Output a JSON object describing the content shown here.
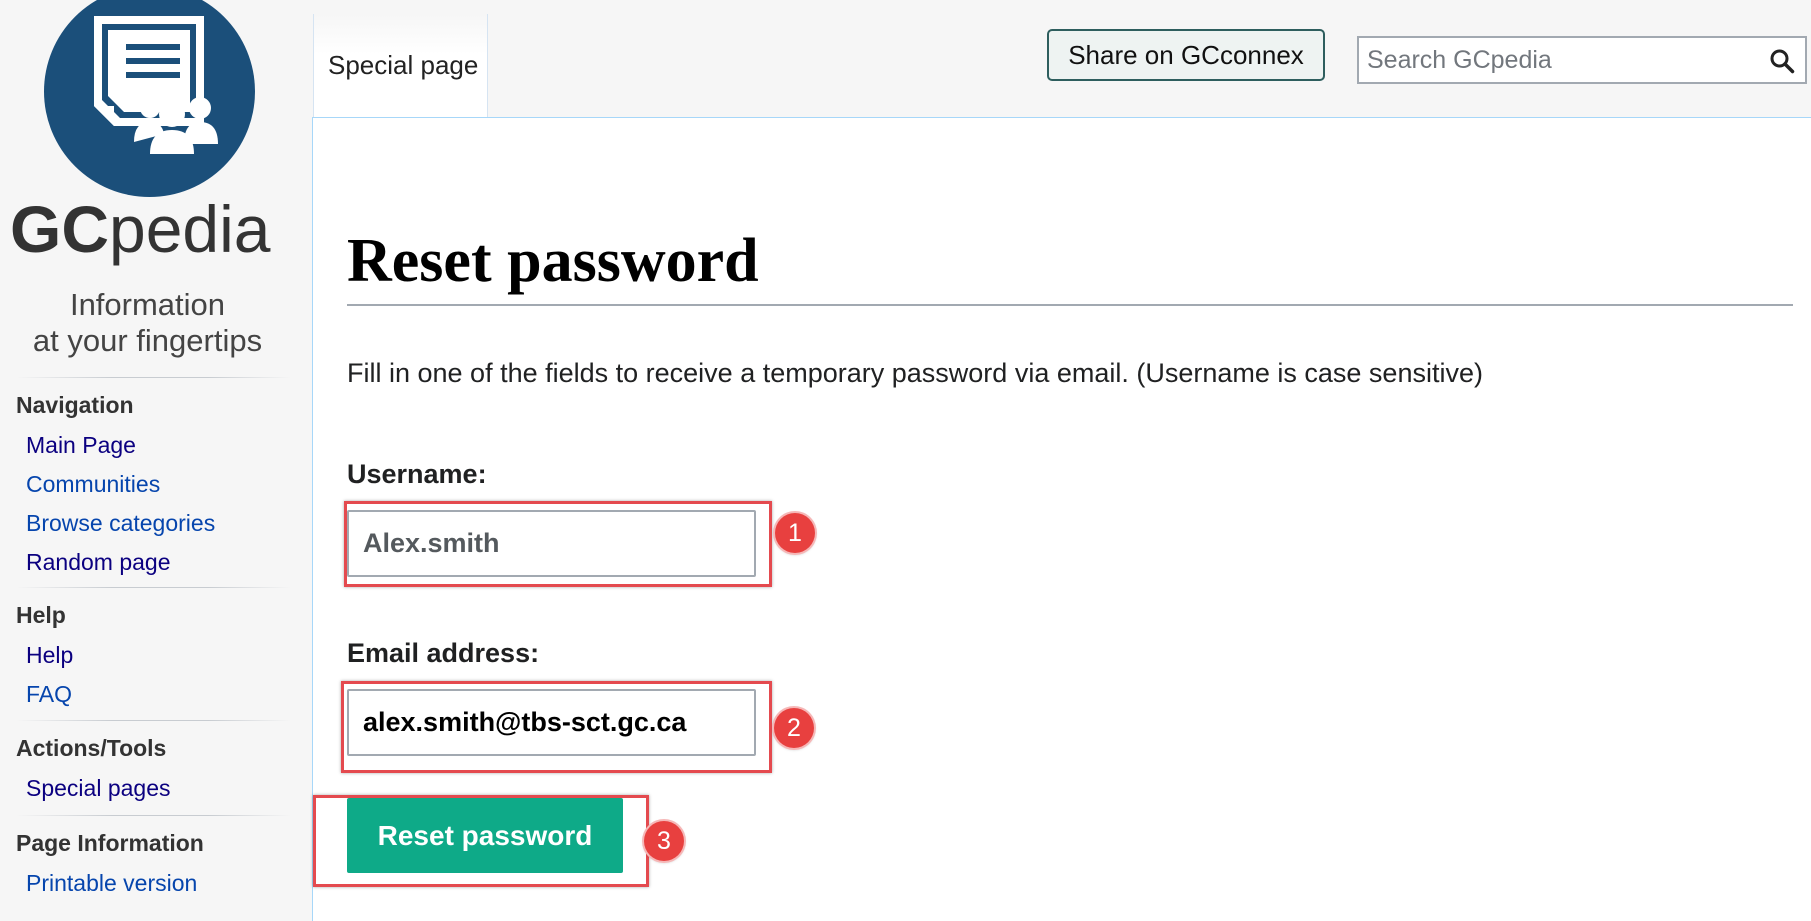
{
  "logo": {
    "word_bold": "GC",
    "word_light": "pedia",
    "tagline_line1": "Information",
    "tagline_line2": "at your fingertips",
    "emblem_icon": "document-people-icon",
    "emblem_color": "#1b4f7a"
  },
  "sidebar": {
    "sections": [
      {
        "heading": "Navigation",
        "items": [
          {
            "label": "Main Page",
            "visited": true
          },
          {
            "label": "Communities",
            "visited": false
          },
          {
            "label": "Browse categories",
            "visited": false
          },
          {
            "label": "Random page",
            "visited": true
          }
        ]
      },
      {
        "heading": "Help",
        "items": [
          {
            "label": "Help",
            "visited": true
          },
          {
            "label": "FAQ",
            "visited": false
          }
        ]
      },
      {
        "heading": "Actions/Tools",
        "items": [
          {
            "label": "Special pages",
            "visited": true
          }
        ]
      },
      {
        "heading": "Page Information",
        "items": [
          {
            "label": "Printable version",
            "visited": false
          }
        ]
      }
    ]
  },
  "tabs": {
    "special_page": "Special page"
  },
  "header": {
    "share_label": "Share on GCconnex",
    "search_placeholder": "Search GCpedia",
    "search_icon": "search-icon"
  },
  "content": {
    "title": "Reset password",
    "intro": "Fill in one of the fields to receive a temporary password via email. (Username is case sensitive)",
    "username_label": "Username:",
    "username_value": "Alex.smith",
    "email_label": "Email address:",
    "email_value": "alex.smith@tbs-sct.gc.ca",
    "submit_label": "Reset password"
  },
  "annotations": {
    "steps": [
      "1",
      "2",
      "3"
    ],
    "color": "#e8403f"
  },
  "colors": {
    "accent_button": "#0eaa88",
    "link": "#0645ad",
    "link_visited": "#0b0080"
  }
}
